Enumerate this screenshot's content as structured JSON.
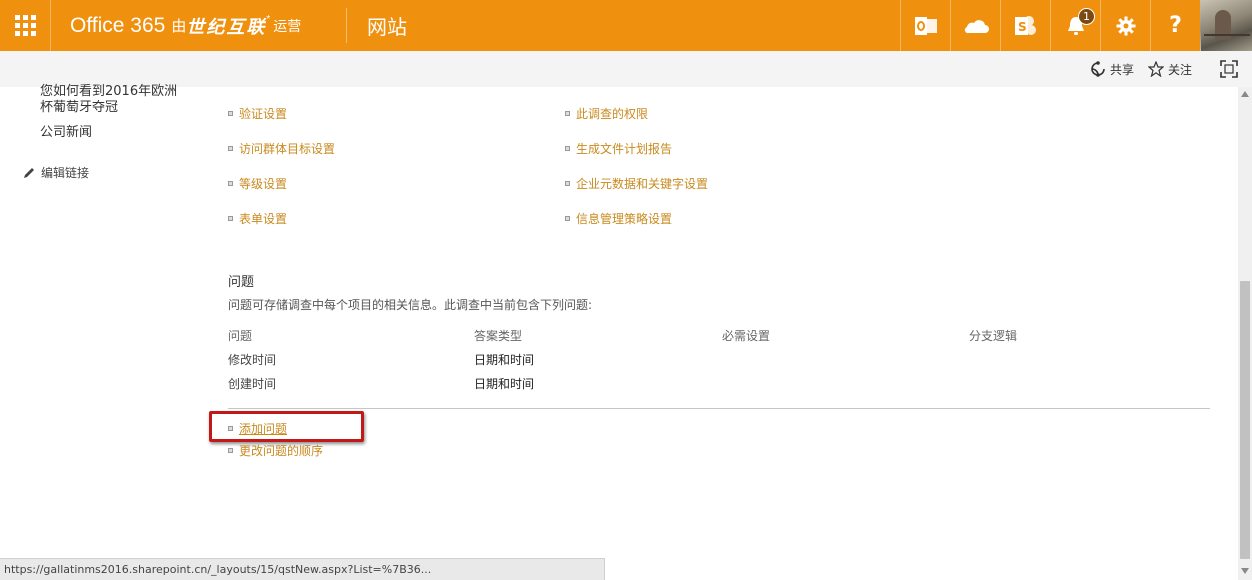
{
  "suitebar": {
    "brand_main": "Office 365",
    "brand_by": "由",
    "brand_partner": "世纪互联",
    "brand_star": "*",
    "brand_operated": "运营",
    "site_name": "网站",
    "notification_count": "1",
    "accent_color": "#f0900f",
    "icons": [
      "app-launcher-icon",
      "outlook-icon",
      "onedrive-icon",
      "sharepoint-icon",
      "bell-icon",
      "gear-icon",
      "help-icon"
    ],
    "help_label": "?"
  },
  "actionbar": {
    "share_label": "共享",
    "follow_label": "关注"
  },
  "leftnav": {
    "items": [
      "您如何看到2016年欧洲",
      "杯葡萄牙夺冠",
      "公司新闻"
    ],
    "edit_links": "编辑链接"
  },
  "settings": {
    "col1": [
      "验证设置",
      "访问群体目标设置",
      "等级设置",
      "表单设置"
    ],
    "col2": [
      "此调查的权限",
      "生成文件计划报告",
      "企业元数据和关键字设置",
      "信息管理策略设置"
    ]
  },
  "questions": {
    "title": "问题",
    "description": "问题可存储调查中每个项目的相关信息。此调查中当前包含下列问题:",
    "headers": [
      "问题",
      "答案类型",
      "必需设置",
      "分支逻辑"
    ],
    "rows": [
      {
        "name": "修改时间",
        "type": "日期和时间"
      },
      {
        "name": "创建时间",
        "type": "日期和时间"
      }
    ],
    "add_question": "添加问题",
    "reorder_questions": "更改问题的顺序"
  },
  "status_url": "https://gallatinms2016.sharepoint.cn/_layouts/15/qstNew.aspx?List=%7B36..."
}
